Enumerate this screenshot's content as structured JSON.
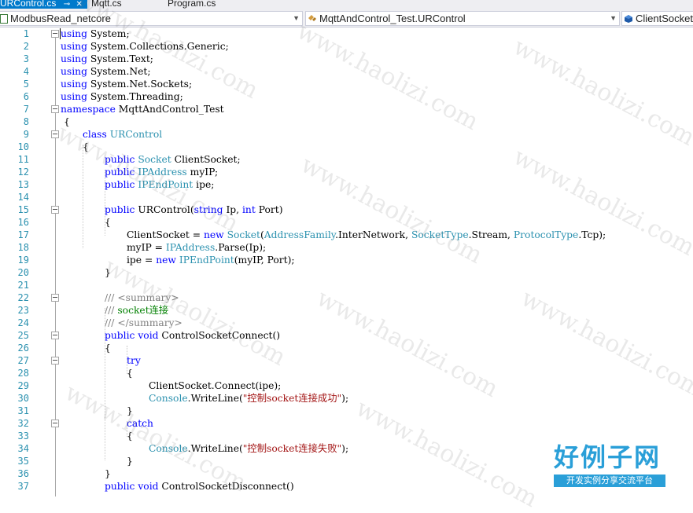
{
  "tabs": [
    {
      "label": "URControl.cs",
      "active": true
    },
    {
      "label": "Mqtt.cs",
      "active": false
    },
    {
      "label": "Program.cs",
      "active": false
    }
  ],
  "navbar": {
    "project": "ModbusRead_netcore",
    "type": "MqttAndControl_Test.URControl",
    "member": "ClientSocket"
  },
  "colors": {
    "keyword": "#0000ff",
    "type": "#2b91af",
    "string": "#a31515",
    "comment": "#008000",
    "line_number": "#2b91af"
  },
  "code_lines": [
    {
      "n": "1",
      "t": [
        [
          "kw",
          "using"
        ],
        [
          "",
          "System;"
        ]
      ]
    },
    {
      "n": "2",
      "t": [
        [
          "kw",
          "using"
        ],
        [
          "",
          "System.Collections.Generic;"
        ]
      ]
    },
    {
      "n": "3",
      "t": [
        [
          "kw",
          "using"
        ],
        [
          "",
          "System.Text;"
        ]
      ]
    },
    {
      "n": "4",
      "t": [
        [
          "kw",
          "using"
        ],
        [
          "",
          "System.Net;"
        ]
      ]
    },
    {
      "n": "5",
      "t": [
        [
          "kw",
          "using"
        ],
        [
          "",
          "System.Net.Sockets;"
        ]
      ]
    },
    {
      "n": "6",
      "t": [
        [
          "kw",
          "using"
        ],
        [
          "",
          "System.Threading;"
        ]
      ]
    },
    {
      "n": "7",
      "t": [
        [
          "kw",
          "namespace"
        ],
        [
          "",
          "MqttAndControl_Test"
        ]
      ]
    },
    {
      "n": "8",
      "t": [
        [
          "",
          "{"
        ]
      ]
    },
    {
      "n": "9",
      "t": [
        [
          "kw",
          "class"
        ],
        [
          "ty",
          "URControl"
        ]
      ]
    },
    {
      "n": "10",
      "t": [
        [
          "",
          "{"
        ]
      ]
    },
    {
      "n": "11",
      "t": [
        [
          "kw",
          "public"
        ],
        [
          "ty",
          "Socket"
        ],
        [
          "",
          "ClientSocket;"
        ]
      ]
    },
    {
      "n": "12",
      "t": [
        [
          "kw",
          "public"
        ],
        [
          "ty",
          "IPAddress"
        ],
        [
          "",
          "myIP;"
        ]
      ]
    },
    {
      "n": "13",
      "t": [
        [
          "kw",
          "public"
        ],
        [
          "ty",
          "IPEndPoint"
        ],
        [
          "",
          "ipe;"
        ]
      ]
    },
    {
      "n": "14",
      "t": []
    },
    {
      "n": "15",
      "t": [
        [
          "kw",
          "public"
        ],
        [
          "",
          "URControl("
        ],
        [
          "kw",
          "string"
        ],
        [
          "",
          "Ip,"
        ],
        [
          "kw",
          "int"
        ],
        [
          "",
          "Port)"
        ]
      ]
    },
    {
      "n": "16",
      "t": [
        [
          "",
          "{"
        ]
      ]
    },
    {
      "n": "17",
      "t": [
        [
          "",
          "ClientSocket ="
        ],
        [
          "kw",
          "new"
        ],
        [
          "ty",
          "Socket"
        ],
        [
          "",
          "("
        ],
        [
          "ty",
          "AddressFamily"
        ],
        [
          "",
          ".InterNetwork,"
        ],
        [
          "ty",
          "SocketType"
        ],
        [
          "",
          ".Stream,"
        ],
        [
          "ty",
          "ProtocolType"
        ],
        [
          "",
          ".Tcp);"
        ]
      ]
    },
    {
      "n": "18",
      "t": [
        [
          "",
          "myIP ="
        ],
        [
          "ty",
          "IPAddress"
        ],
        [
          "",
          ".Parse(Ip);"
        ]
      ]
    },
    {
      "n": "19",
      "t": [
        [
          "",
          "ipe ="
        ],
        [
          "kw",
          "new"
        ],
        [
          "ty",
          "IPEndPoint"
        ],
        [
          "",
          "(myIP, Port);"
        ]
      ]
    },
    {
      "n": "20",
      "t": [
        [
          "",
          "}"
        ]
      ]
    },
    {
      "n": "21",
      "t": []
    },
    {
      "n": "22",
      "t": [
        [
          "doc",
          "///"
        ],
        [
          "doc",
          "<summary>"
        ]
      ]
    },
    {
      "n": "23",
      "t": [
        [
          "doc",
          "///"
        ],
        [
          "cm",
          "socket连接"
        ]
      ]
    },
    {
      "n": "24",
      "t": [
        [
          "doc",
          "///"
        ],
        [
          "doc",
          "</summary>"
        ]
      ]
    },
    {
      "n": "25",
      "t": [
        [
          "kw",
          "public"
        ],
        [
          "kw",
          "void"
        ],
        [
          "",
          "ControlSocketConnect()"
        ]
      ]
    },
    {
      "n": "26",
      "t": [
        [
          "",
          "{"
        ]
      ]
    },
    {
      "n": "27",
      "t": [
        [
          "kw",
          "try"
        ]
      ]
    },
    {
      "n": "28",
      "t": [
        [
          "",
          "{"
        ]
      ]
    },
    {
      "n": "29",
      "t": [
        [
          "",
          "ClientSocket.Connect(ipe);"
        ]
      ]
    },
    {
      "n": "30",
      "t": [
        [
          "ty",
          "Console"
        ],
        [
          "",
          ".WriteLine("
        ],
        [
          "st",
          "\"控制socket连接成功\""
        ],
        [
          "",
          ");"
        ]
      ]
    },
    {
      "n": "31",
      "t": [
        [
          "",
          "}"
        ]
      ]
    },
    {
      "n": "32",
      "t": [
        [
          "kw",
          "catch"
        ]
      ]
    },
    {
      "n": "33",
      "t": [
        [
          "",
          "{"
        ]
      ]
    },
    {
      "n": "34",
      "t": [
        [
          "ty",
          "Console"
        ],
        [
          "",
          ".WriteLine("
        ],
        [
          "st",
          "\"控制socket连接失败\""
        ],
        [
          "",
          ");"
        ]
      ]
    },
    {
      "n": "35",
      "t": [
        [
          "",
          "}"
        ]
      ]
    },
    {
      "n": "36",
      "t": [
        [
          "",
          "}"
        ]
      ]
    },
    {
      "n": "37",
      "t": [
        [
          "kw",
          "public"
        ],
        [
          "kw",
          "void"
        ],
        [
          "",
          "ControlSocketDisconnect()"
        ]
      ]
    }
  ],
  "watermark": "www.haolizi.com",
  "logo": {
    "title": "好例子网",
    "subtitle": "开发实例分享交流平台"
  }
}
